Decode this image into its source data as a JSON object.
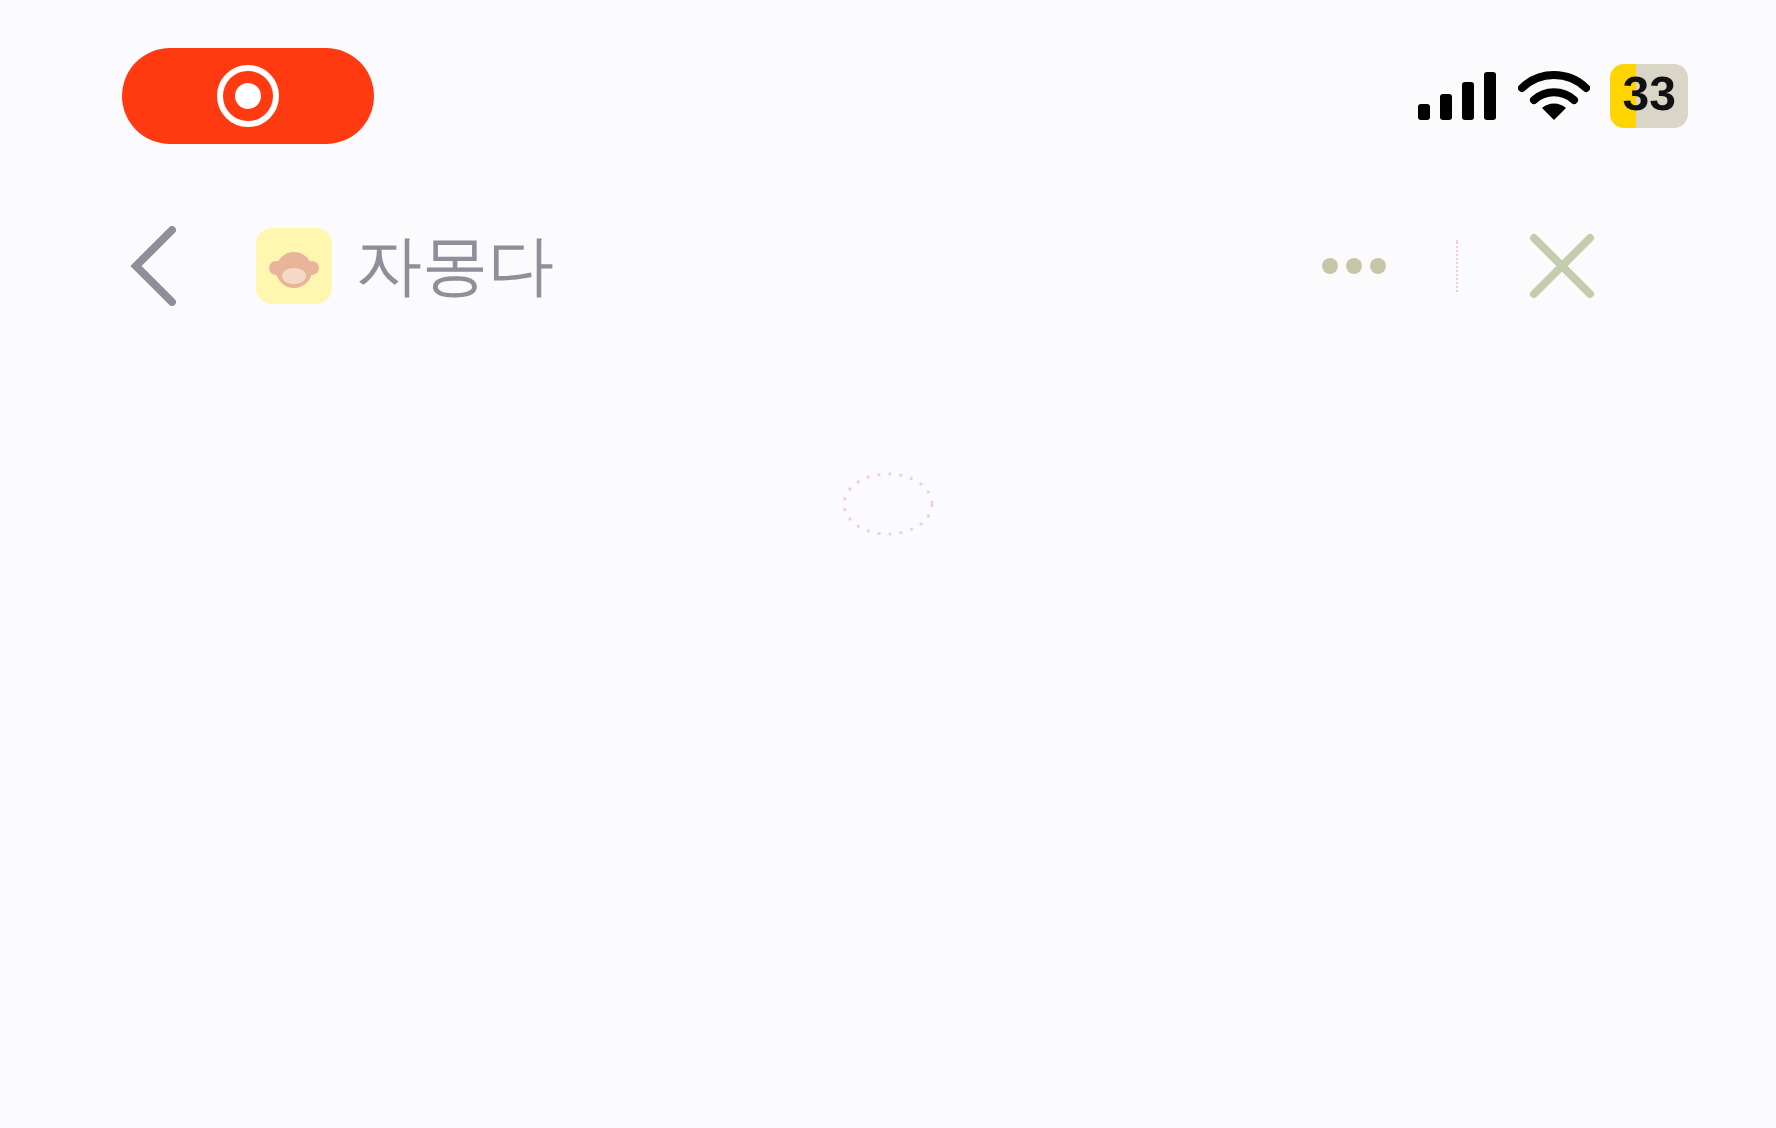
{
  "status_bar": {
    "recording": true,
    "battery": "33"
  },
  "nav": {
    "title": "자몽다"
  },
  "content": {
    "loading": true
  }
}
